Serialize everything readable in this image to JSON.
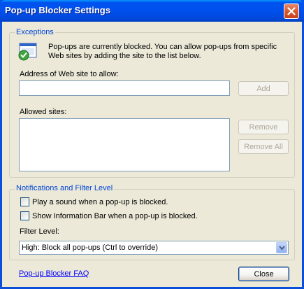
{
  "window": {
    "title": "Pop-up Blocker Settings"
  },
  "exceptions": {
    "group_label": "Exceptions",
    "info_text": "Pop-ups are currently blocked.  You can allow pop-ups from specific Web sites by adding the site to the list below.",
    "address_label": "Address of Web site to allow:",
    "address_value": "",
    "add_label": "Add",
    "allowed_label": "Allowed sites:",
    "allowed_sites": [],
    "remove_label": "Remove",
    "remove_all_label": "Remove All"
  },
  "notifications": {
    "group_label": "Notifications and Filter Level",
    "play_sound_label": "Play a sound when a pop-up is blocked.",
    "play_sound_checked": false,
    "info_bar_label": "Show Information Bar when a pop-up is blocked.",
    "info_bar_checked": false,
    "filter_label": "Filter Level:",
    "filter_value": "High: Block all pop-ups (Ctrl to override)"
  },
  "footer": {
    "faq_link": "Pop-up Blocker FAQ",
    "close_label": "Close"
  }
}
